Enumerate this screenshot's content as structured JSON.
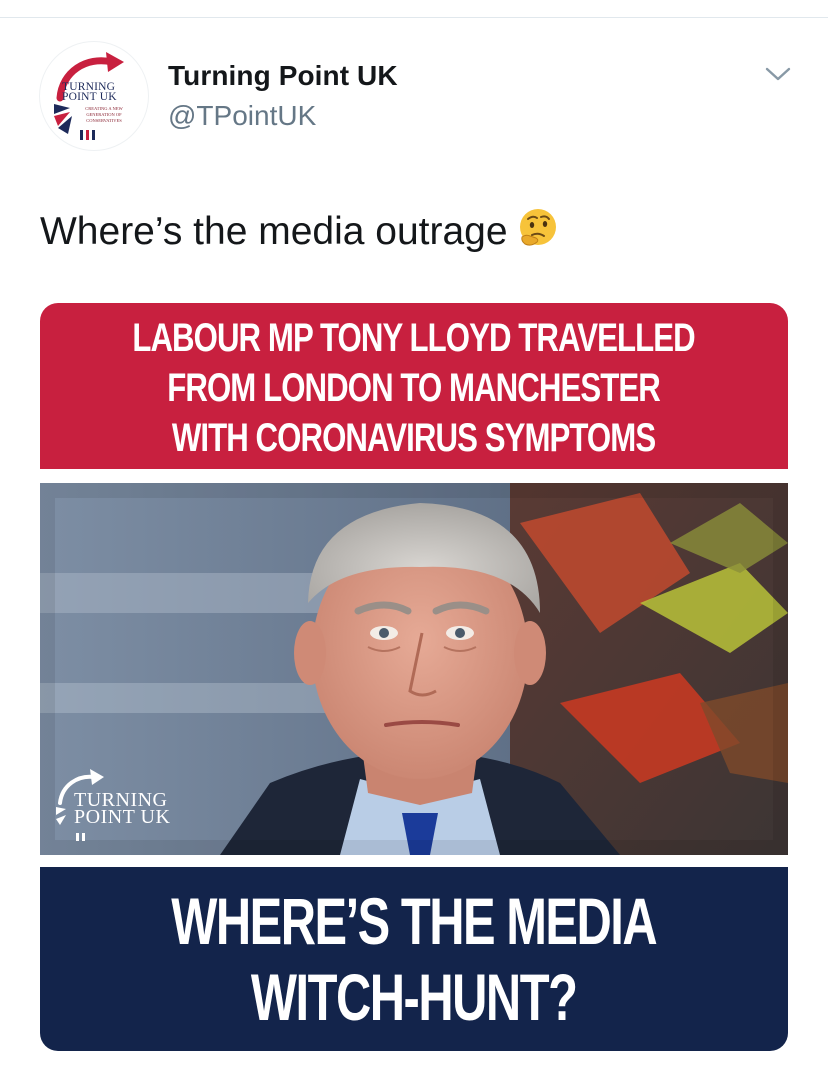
{
  "tweet": {
    "author": {
      "display_name": "Turning Point UK",
      "handle": "@TPointUK",
      "avatar": {
        "name_line1": "TURNING",
        "name_line2": "POINT UK",
        "tagline": "CREATING A NEW GENERATION OF CONSERVATIVES"
      }
    },
    "menu_icon": "chevron-down-icon",
    "text": "Where’s the media outrage",
    "emoji": "thinking-face"
  },
  "media": {
    "headline_lines": [
      "LABOUR MP TONY LLOYD TRAVELLED",
      "FROM LONDON TO MANCHESTER",
      "WITH CORONAVIRUS SYMPTOMS"
    ],
    "watermark": {
      "line1": "TURNING",
      "line2": "POINT UK"
    },
    "question_lines": [
      "WHERE’S THE MEDIA",
      "WITCH-HUNT?"
    ],
    "colors": {
      "red_banner": "#c8203f",
      "navy_banner": "#13244b"
    }
  }
}
